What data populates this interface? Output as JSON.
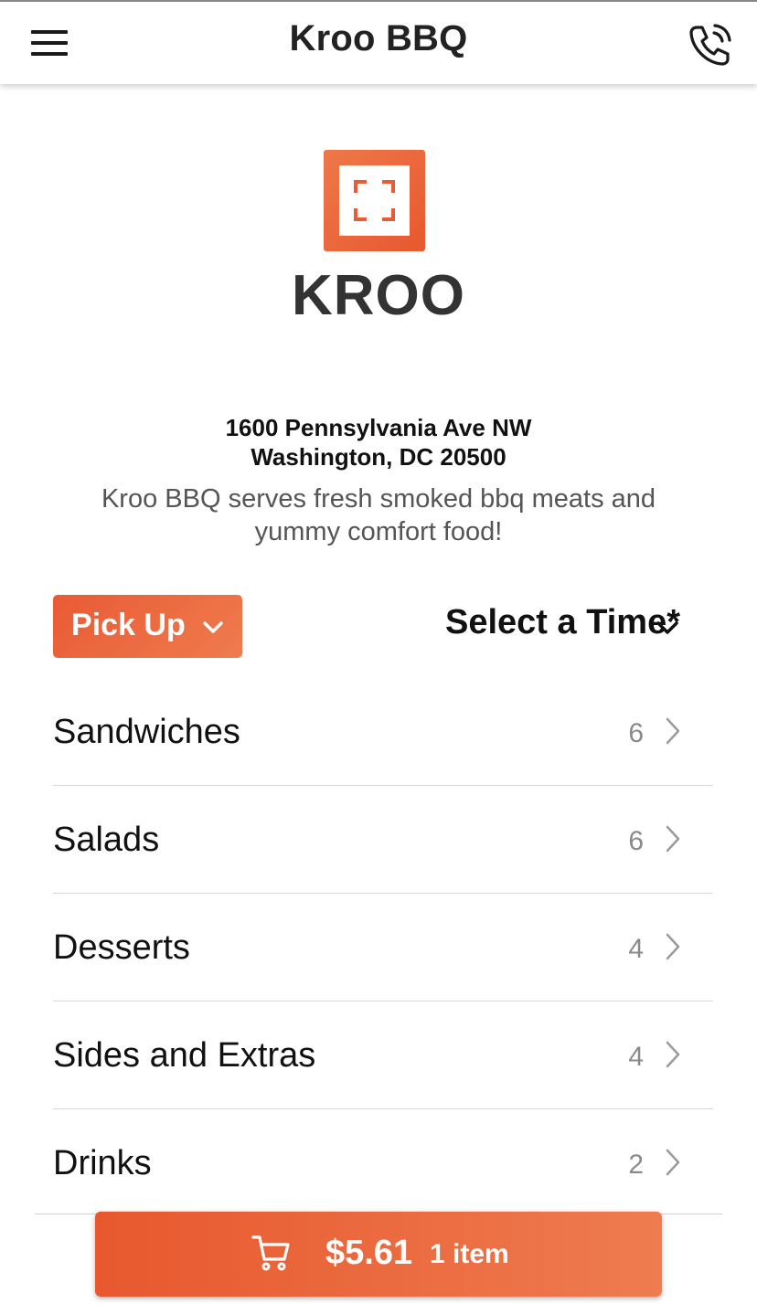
{
  "app": {
    "title": "Kroo BBQ"
  },
  "header": {
    "menu_icon": "hamburger-menu-icon",
    "call_icon": "phone-call-icon"
  },
  "brand": {
    "logo_text": "KROO",
    "accent": "#E95B34"
  },
  "restaurant": {
    "address_line1": "1600 Pennsylvania Ave NW",
    "address_line2": "Washington, DC 20500",
    "description": "Kroo BBQ serves fresh smoked bbq meats and yummy comfort food!"
  },
  "order": {
    "type_label": "Pick Up",
    "time_label": "Select a Time*"
  },
  "categories": [
    {
      "name": "Sandwiches",
      "count": "6"
    },
    {
      "name": "Salads",
      "count": "6"
    },
    {
      "name": "Desserts",
      "count": "4"
    },
    {
      "name": "Sides and Extras",
      "count": "4"
    },
    {
      "name": "Drinks",
      "count": "2"
    }
  ],
  "cart": {
    "total": "$5.61",
    "items": "1 item",
    "icon": "shopping-cart-icon"
  }
}
